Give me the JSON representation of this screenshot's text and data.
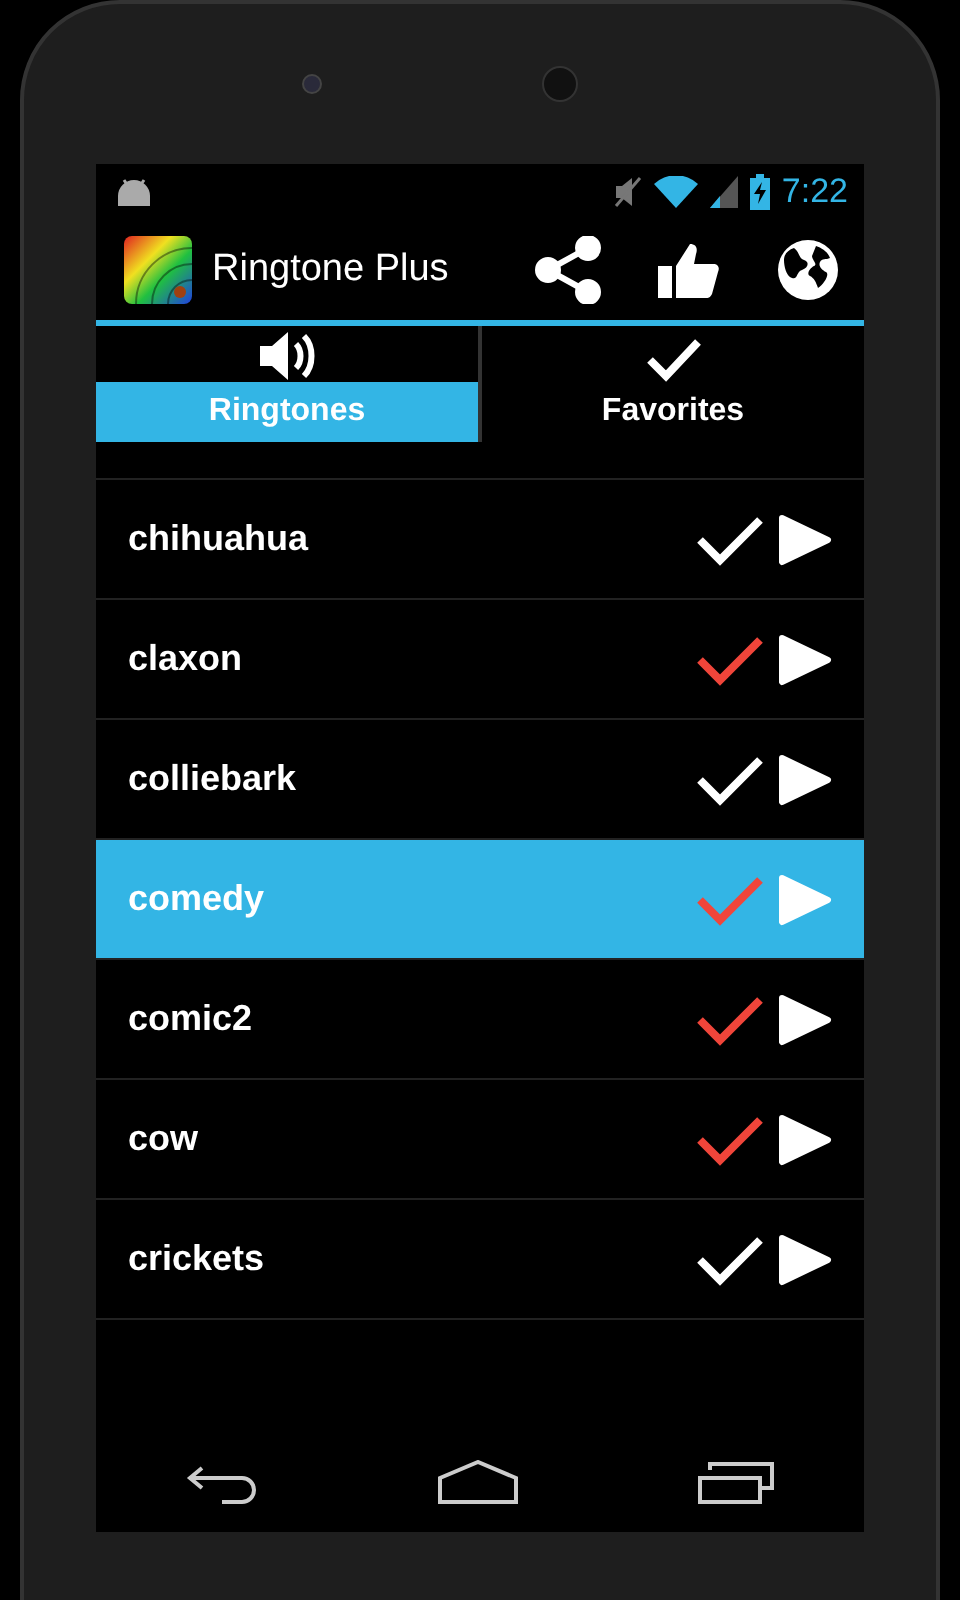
{
  "status_bar": {
    "time": "7:22"
  },
  "action_bar": {
    "title": "Ringtone Plus",
    "actions": [
      {
        "kind": "share"
      },
      {
        "kind": "like"
      },
      {
        "kind": "globe"
      }
    ]
  },
  "tabs": [
    {
      "label": "Ringtones",
      "kind": "sound",
      "selected": true
    },
    {
      "label": "Favorites",
      "kind": "check",
      "selected": false
    }
  ],
  "rows": [
    {
      "name": "chihuahua",
      "favorite": false,
      "selected": false
    },
    {
      "name": "claxon",
      "favorite": true,
      "selected": false
    },
    {
      "name": "colliebark",
      "favorite": false,
      "selected": false
    },
    {
      "name": "comedy",
      "favorite": true,
      "selected": true
    },
    {
      "name": "comic2",
      "favorite": true,
      "selected": false
    },
    {
      "name": "cow",
      "favorite": true,
      "selected": false
    },
    {
      "name": "crickets",
      "favorite": false,
      "selected": false
    }
  ]
}
